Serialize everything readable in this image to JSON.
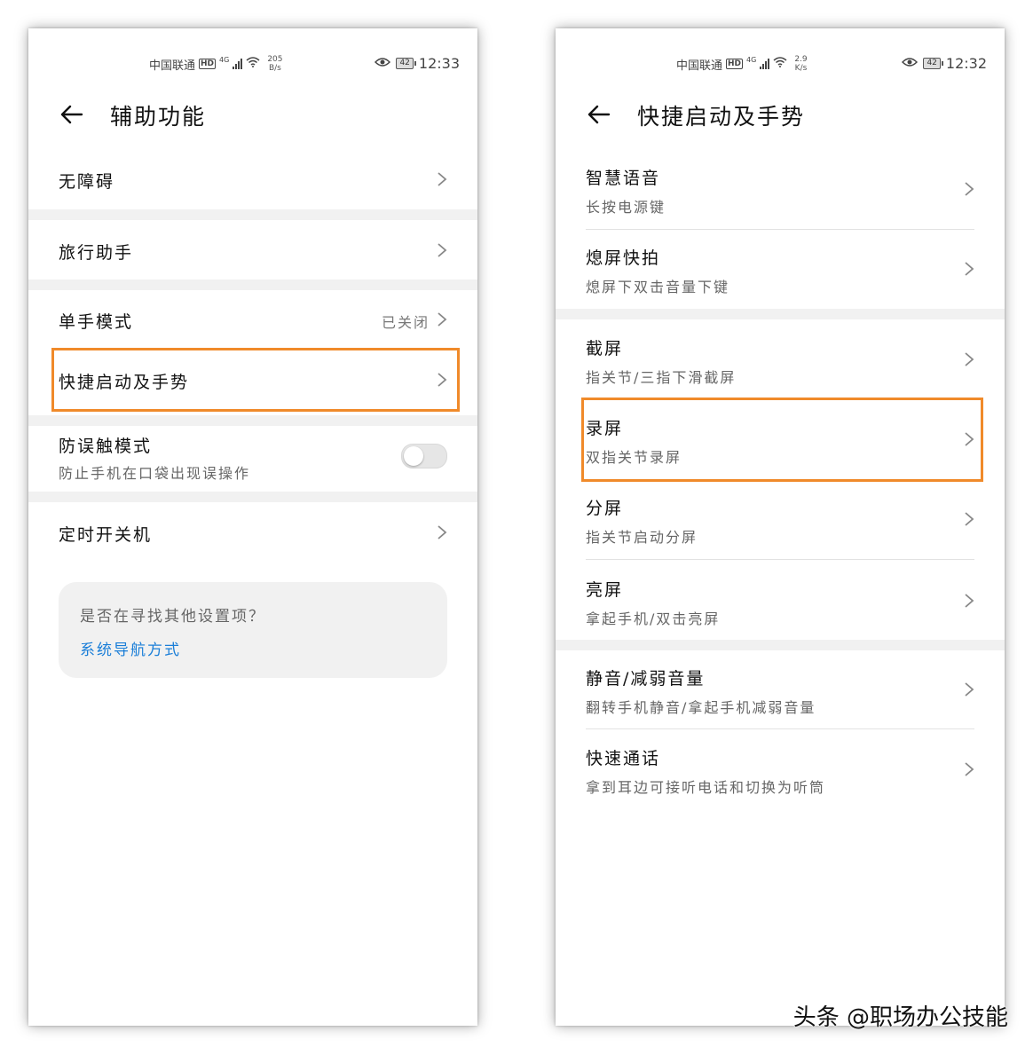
{
  "left_phone": {
    "status": {
      "carrier": "中国联通",
      "hd": "HD",
      "network": "4G",
      "speed_value": "205",
      "speed_unit": "B/s",
      "battery": "42",
      "time": "12:33"
    },
    "title": "辅助功能",
    "items": {
      "accessibility": "无障碍",
      "travel_assistant": "旅行助手",
      "one_hand": "单手模式",
      "one_hand_value": "已关闭",
      "shortcuts": "快捷启动及手势",
      "pocket_mode": "防误触模式",
      "pocket_mode_desc": "防止手机在口袋出现误操作",
      "pocket_mode_on": false,
      "scheduled_power": "定时开关机"
    },
    "suggest": {
      "question": "是否在寻找其他设置项？",
      "link": "系统导航方式"
    }
  },
  "right_phone": {
    "status": {
      "carrier": "中国联通",
      "hd": "HD",
      "network": "4G",
      "speed_value": "2.9",
      "speed_unit": "K/s",
      "battery": "42",
      "time": "12:32"
    },
    "title": "快捷启动及手势",
    "items": [
      {
        "label": "智慧语音",
        "desc": "长按电源键"
      },
      {
        "label": "熄屏快拍",
        "desc": "熄屏下双击音量下键"
      },
      {
        "label": "截屏",
        "desc": "指关节/三指下滑截屏"
      },
      {
        "label": "录屏",
        "desc": "双指关节录屏"
      },
      {
        "label": "分屏",
        "desc": "指关节启动分屏"
      },
      {
        "label": "亮屏",
        "desc": "拿起手机/双击亮屏"
      },
      {
        "label": "静音/减弱音量",
        "desc": "翻转手机静音/拿起手机减弱音量"
      },
      {
        "label": "快速通话",
        "desc": "拿到耳边可接听电话和切换为听筒"
      }
    ]
  },
  "watermark": "头条 @职场办公技能",
  "colors": {
    "highlight": "#f08a2a",
    "link": "#1a7ed8",
    "band": "#f1f1f1"
  }
}
